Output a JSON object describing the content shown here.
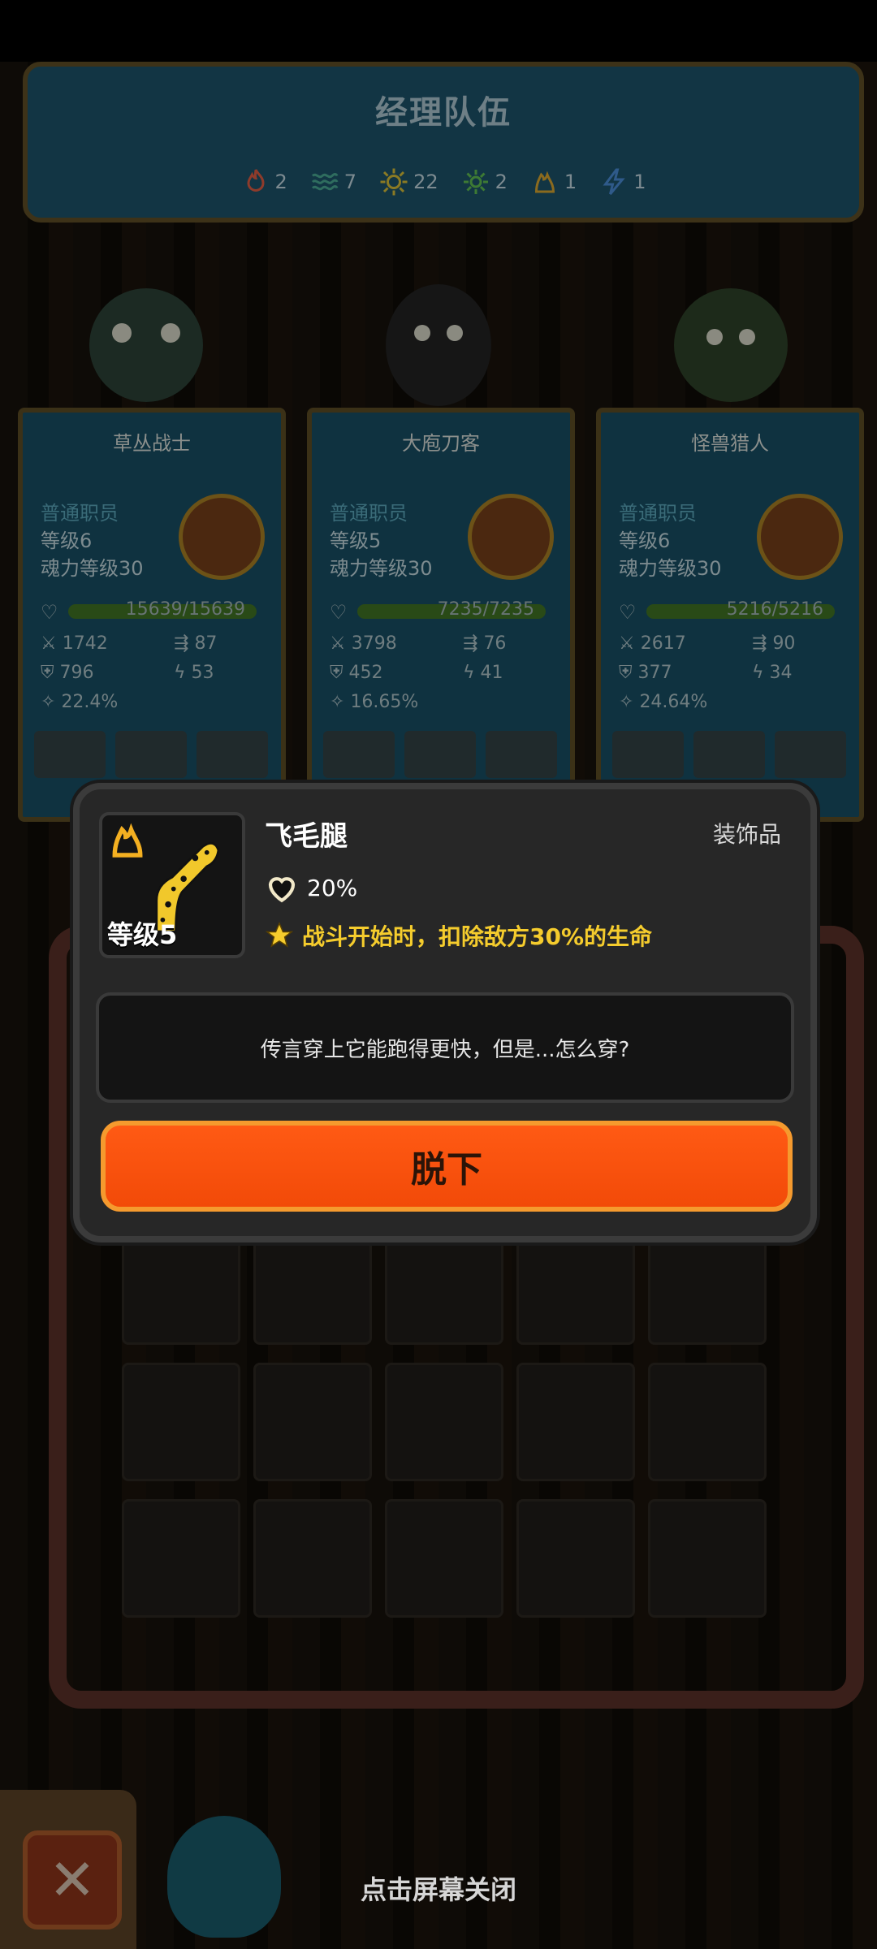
{
  "team": {
    "title": "经理队伍",
    "elements": [
      {
        "icon": "fire-icon",
        "count": "2"
      },
      {
        "icon": "water-wave-icon",
        "count": "7"
      },
      {
        "icon": "sun-icon",
        "count": "22"
      },
      {
        "icon": "gear-leaf-icon",
        "count": "2"
      },
      {
        "icon": "flame-outline-icon",
        "count": "1"
      },
      {
        "icon": "lightning-icon",
        "count": "1"
      }
    ]
  },
  "heroes": [
    {
      "name": "草丛战士",
      "rank": "普通职员",
      "level": "等级6",
      "soul": "魂力等级30",
      "hp": "15639/15639",
      "attack": "1742",
      "speed": "87",
      "defense": "796",
      "energy": "53",
      "crit": "22.4%"
    },
    {
      "name": "大庖刀客",
      "rank": "普通职员",
      "level": "等级5",
      "soul": "魂力等级30",
      "hp": "7235/7235",
      "attack": "3798",
      "speed": "76",
      "defense": "452",
      "energy": "41",
      "crit": "16.65%"
    },
    {
      "name": "怪兽猎人",
      "rank": "普通职员",
      "level": "等级6",
      "soul": "魂力等级30",
      "hp": "5216/5216",
      "attack": "2617",
      "speed": "90",
      "defense": "377",
      "energy": "34",
      "crit": "24.64%"
    }
  ],
  "item": {
    "name": "飞毛腿",
    "type": "装饰品",
    "level": "等级5",
    "stat": "20%",
    "effect": "战斗开始时，扣除敌方30%的生命",
    "description": "传言穿上它能跑得更快，但是...怎么穿?",
    "action": "脱下",
    "colors": {
      "accent": "#ff5a14",
      "effect_text": "#f5cc2d"
    }
  },
  "footer": {
    "hint": "点击屏幕关闭"
  }
}
